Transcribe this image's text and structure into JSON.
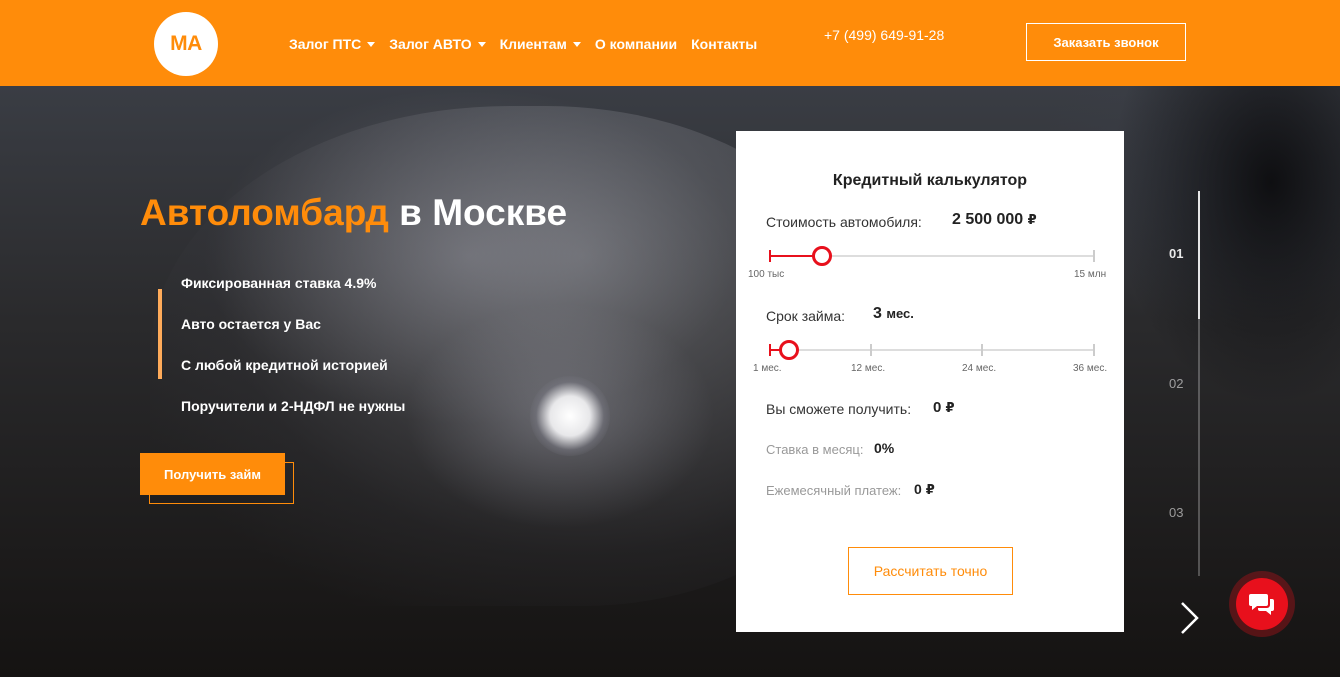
{
  "header": {
    "logo_text": "MA",
    "nav": [
      {
        "label": "Залог ПТС",
        "has_dropdown": true
      },
      {
        "label": "Залог АВТО",
        "has_dropdown": true
      },
      {
        "label": "Клиентам",
        "has_dropdown": true
      },
      {
        "label": "О компании",
        "has_dropdown": false
      },
      {
        "label": "Контакты",
        "has_dropdown": false
      }
    ],
    "phone": "+7 (499) 649-91-28",
    "callback_label": "Заказать звонок"
  },
  "hero": {
    "title_accent": "Автоломбард",
    "title_rest": " в Москве",
    "features": [
      "Фиксированная ставка 4.9%",
      "Авто остается у Вас",
      "С любой кредитной историей",
      "Поручители и 2-НДФЛ не нужны"
    ],
    "cta_label": "Получить займ"
  },
  "calculator": {
    "title": "Кредитный калькулятор",
    "car_value_label": "Стоимость автомобиля:",
    "car_value": "2 500 000",
    "car_value_unit": "₽",
    "car_slider_fraction": 0.16,
    "car_min_label": "100 тыс",
    "car_max_label": "15 млн",
    "term_label": "Срок займа:",
    "term_value": "3",
    "term_unit": "мес.",
    "term_slider_fraction": 0.06,
    "term_scale": [
      "1 мес.",
      "12 мес.",
      "24 мес.",
      "36 мес."
    ],
    "receive_label": "Вы сможете получить:",
    "receive_value": "0",
    "receive_unit": "₽",
    "rate_label": "Ставка в месяц:",
    "rate_value": "0%",
    "payment_label": "Ежемесячный платеж:",
    "payment_value": "0",
    "payment_unit": "₽",
    "calc_button": "Рассчитать точно"
  },
  "slides": {
    "items": [
      "01",
      "02",
      "03"
    ],
    "active": "01"
  },
  "colors": {
    "accent": "#ff8c0a",
    "slider": "#e8101c",
    "chat": "#e8101c"
  },
  "icons": {
    "next": "chevron-right-icon",
    "chat": "chat-bubbles-icon",
    "dropdown": "caret-down-icon"
  }
}
